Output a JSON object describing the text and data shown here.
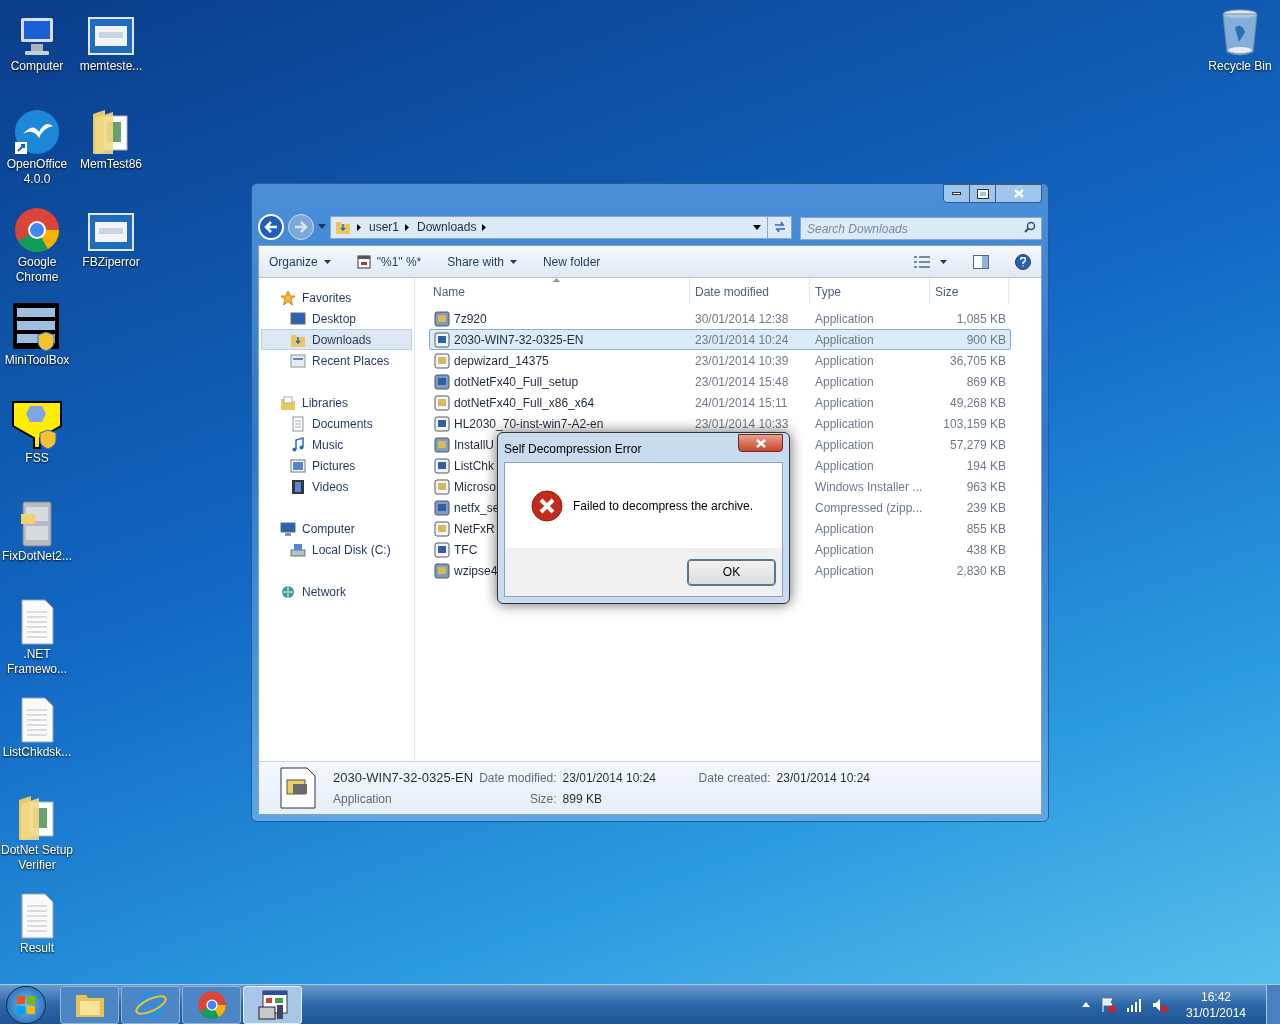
{
  "desktop": {
    "columns": [
      [
        {
          "label": "Computer",
          "kind": "computer"
        },
        {
          "label": "OpenOffice 4.0.0",
          "kind": "openoffice"
        },
        {
          "label": "Google Chrome",
          "kind": "chrome"
        },
        {
          "label": "MiniToolBox",
          "kind": "toolbox"
        },
        {
          "label": "FSS",
          "kind": "fss"
        },
        {
          "label": "FixDotNet2...",
          "kind": "cabinet"
        },
        {
          "label": ".NET Framewo...",
          "kind": "text"
        },
        {
          "label": "ListChkdsk...",
          "kind": "text"
        },
        {
          "label": "DotNet Setup Verifier",
          "kind": "folder"
        },
        {
          "label": "Result",
          "kind": "text"
        }
      ],
      [
        {
          "label": "memteste...",
          "kind": "screen"
        },
        {
          "label": "MemTest86",
          "kind": "folder"
        },
        {
          "label": "FBZiperror",
          "kind": "screen"
        }
      ]
    ],
    "right": [
      {
        "label": "Recycle Bin",
        "kind": "recycle"
      }
    ]
  },
  "explorer": {
    "address": [
      "user1",
      "Downloads"
    ],
    "search": {
      "placeholder": "Search Downloads"
    },
    "toolbar": [
      {
        "label": "Organize",
        "dropdown": true
      },
      {
        "label": "\"%1\" %*",
        "dropdown": false
      },
      {
        "label": "Share with",
        "dropdown": true
      },
      {
        "label": "New folder",
        "dropdown": false
      }
    ],
    "nav": [
      {
        "label": "Favorites",
        "kind": "star",
        "selected": false,
        "children": [
          {
            "label": "Desktop",
            "kind": "desktop",
            "selected": false
          },
          {
            "label": "Downloads",
            "kind": "folder",
            "selected": true
          },
          {
            "label": "Recent Places",
            "kind": "recent",
            "selected": false
          }
        ]
      },
      {
        "label": "Libraries",
        "kind": "library",
        "selected": false,
        "children": [
          {
            "label": "Documents",
            "kind": "documents",
            "selected": false
          },
          {
            "label": "Music",
            "kind": "music",
            "selected": false
          },
          {
            "label": "Pictures",
            "kind": "pictures",
            "selected": false
          },
          {
            "label": "Videos",
            "kind": "videos",
            "selected": false
          }
        ]
      },
      {
        "label": "Computer",
        "kind": "computer",
        "selected": false,
        "children": [
          {
            "label": "Local Disk (C:)",
            "kind": "disk",
            "selected": false
          }
        ]
      },
      {
        "label": "Network",
        "kind": "network",
        "selected": false
      }
    ],
    "columns": [
      "Name",
      "Date modified",
      "Type",
      "Size"
    ],
    "files": [
      {
        "name": "7z920",
        "date": "30/01/2014 12:38",
        "type": "Application",
        "size": "1,085 KB",
        "selected": false
      },
      {
        "name": "2030-WIN7-32-0325-EN",
        "date": "23/01/2014 10:24",
        "type": "Application",
        "size": "900 KB",
        "selected": true
      },
      {
        "name": "depwizard_14375",
        "date": "23/01/2014 10:39",
        "type": "Application",
        "size": "36,705 KB",
        "selected": false
      },
      {
        "name": "dotNetFx40_Full_setup",
        "date": "23/01/2014 15:48",
        "type": "Application",
        "size": "869 KB",
        "selected": false
      },
      {
        "name": "dotNetFx40_Full_x86_x64",
        "date": "24/01/2014 15:11",
        "type": "Application",
        "size": "49,268 KB",
        "selected": false
      },
      {
        "name": "HL2030_70-inst-win7-A2-en",
        "date": "23/01/2014 10:33",
        "type": "Application",
        "size": "103,159 KB",
        "selected": false
      },
      {
        "name": "InstallU",
        "type": "Application",
        "size": "57,279 KB",
        "selected": false
      },
      {
        "name": "ListChk",
        "type": "Application",
        "size": "194 KB",
        "selected": false
      },
      {
        "name": "Microso",
        "type": "Windows Installer ...",
        "size": "963 KB",
        "selected": false
      },
      {
        "name": "netfx_se",
        "type": "Compressed (zipp...",
        "size": "239 KB",
        "selected": false
      },
      {
        "name": "NetFxR",
        "type": "Application",
        "size": "855 KB",
        "selected": false
      },
      {
        "name": "TFC",
        "type": "Application",
        "size": "438 KB",
        "selected": false
      },
      {
        "name": "wzipse4",
        "type": "Application",
        "size": "2,830 KB",
        "selected": false
      }
    ],
    "details": {
      "name": "2030-WIN7-32-0325-EN",
      "type": "Application",
      "modified_label": "Date modified:",
      "modified": "23/01/2014 10:24",
      "size_label": "Size:",
      "size": "899 KB",
      "created_label": "Date created:",
      "created": "23/01/2014 10:24"
    }
  },
  "dialog": {
    "title": "Self Decompression Error",
    "message": "Failed to decompress the archive.",
    "button": "OK"
  },
  "taskbar": {
    "items": [
      {
        "kind": "explorer",
        "active": false
      },
      {
        "kind": "ie",
        "active": false
      },
      {
        "kind": "chrome",
        "active": false
      },
      {
        "kind": "zip",
        "active": true
      }
    ],
    "clock": {
      "time": "16:42",
      "date": "31/01/2014"
    }
  }
}
